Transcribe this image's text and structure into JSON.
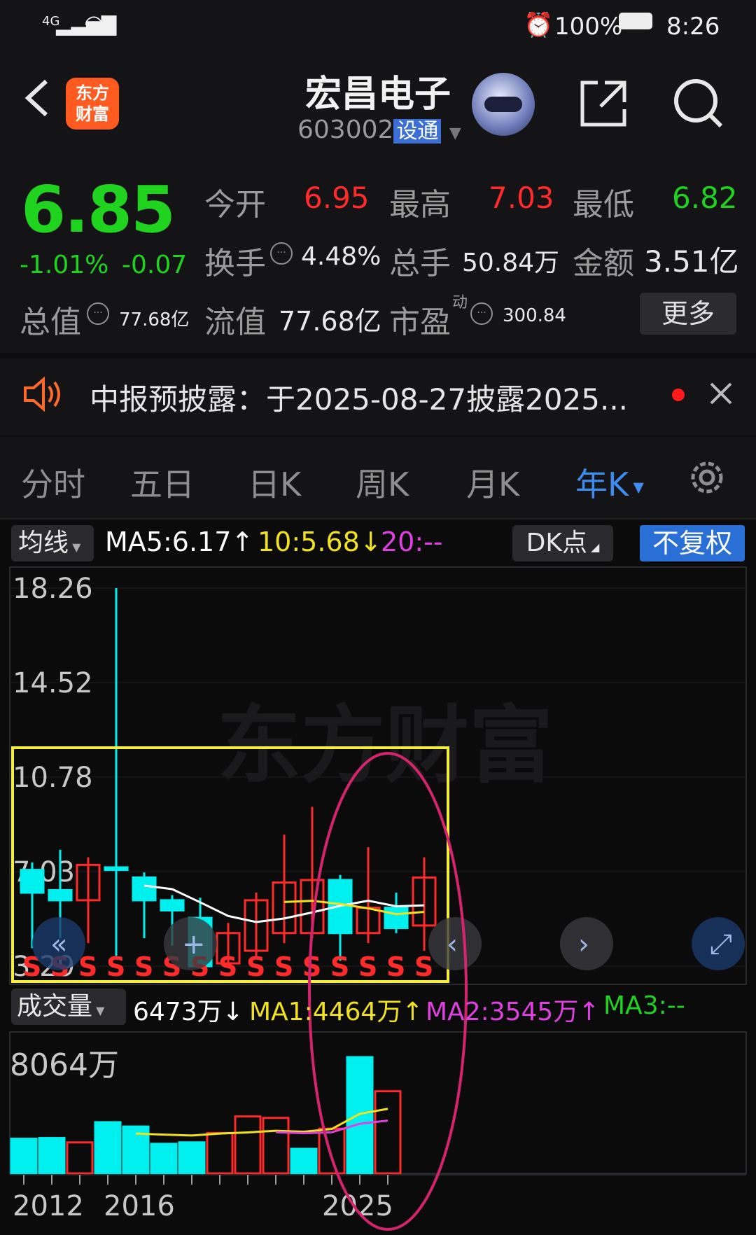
{
  "status": {
    "network": "4G",
    "battery": "100%",
    "time": "8:26"
  },
  "header": {
    "title": "宏昌电子",
    "code": "603002",
    "badge": "设通",
    "logo_line1": "东方",
    "logo_line2": "财富"
  },
  "quote": {
    "price": "6.85",
    "change_pct": "-1.01%",
    "change": "-0.07",
    "open_label": "今开",
    "open": "6.95",
    "high_label": "最高",
    "high": "7.03",
    "low_label": "最低",
    "low": "6.82",
    "turnover_label": "换手",
    "turnover": "4.48%",
    "volume_label": "总手",
    "volume": "50.84万",
    "amount_label": "金额",
    "amount": "3.51亿",
    "mktcap_label": "总值",
    "mktcap": "77.68亿",
    "float_label": "流值",
    "float": "77.68亿",
    "pe_label": "市盈",
    "pe_sup": "动",
    "pe": "300.84",
    "more_label": "更多"
  },
  "notice": {
    "text": "中报预披露：于2025-08-27披露2025..."
  },
  "tabs": [
    "分时",
    "五日",
    "日K",
    "周K",
    "月K",
    "年K"
  ],
  "active_tab": "年K",
  "indicators": {
    "ma_selector": "均线",
    "ma5": "MA5:6.17↑",
    "ma10": "10:5.68↓",
    "ma20": "20:--",
    "dk": "DK点",
    "adjust": "不复权"
  },
  "volume_bar": {
    "selector": "成交量",
    "current": "6473万↓",
    "ma1": "MA1:4464万↑",
    "ma2": "MA2:3545万↑",
    "ma3": "MA3:--"
  },
  "watermark": "东方财富",
  "colors": {
    "up": "#ff2a2a",
    "down": "#00f0f0",
    "ma5": "#ffffff",
    "ma10": "#f2e21e",
    "ma20": "#e040e0",
    "accent": "#3d8cf0"
  },
  "chart_data": {
    "type": "candlestick",
    "price_axis_labels": [
      "18.26",
      "14.52",
      "10.78",
      "7.03",
      "3.29"
    ],
    "volume_axis_label": "8064万",
    "x_tick_labels": [
      "2012",
      "2016",
      "2025"
    ],
    "signal_label": "S",
    "candles": [
      {
        "o": 7.1,
        "c": 6.2,
        "h": 7.4,
        "l": 4.0
      },
      {
        "o": 6.3,
        "c": 5.9,
        "h": 7.9,
        "l": 4.4
      },
      {
        "o": 5.9,
        "c": 7.3,
        "h": 7.6,
        "l": 4.2
      },
      {
        "o": 7.2,
        "c": 7.1,
        "h": 18.26,
        "l": 3.7
      },
      {
        "o": 6.8,
        "c": 5.9,
        "h": 7.0,
        "l": 4.4
      },
      {
        "o": 5.9,
        "c": 5.5,
        "h": 6.1,
        "l": 4.1
      },
      {
        "o": 5.2,
        "c": 3.29,
        "h": 6.0,
        "l": 3.29
      },
      {
        "o": 3.4,
        "c": 4.6,
        "h": 5.0,
        "l": 3.3
      },
      {
        "o": 3.9,
        "c": 5.9,
        "h": 6.2,
        "l": 3.6
      },
      {
        "o": 4.6,
        "c": 6.6,
        "h": 8.5,
        "l": 4.2
      },
      {
        "o": 4.6,
        "c": 6.7,
        "h": 9.6,
        "l": 4.4
      },
      {
        "o": 6.7,
        "c": 4.6,
        "h": 6.9,
        "l": 3.5
      },
      {
        "o": 4.6,
        "c": 5.6,
        "h": 8.0,
        "l": 4.2
      },
      {
        "o": 5.6,
        "c": 4.8,
        "h": 6.2,
        "l": 4.6
      },
      {
        "o": 4.9,
        "c": 6.8,
        "h": 7.6,
        "l": 3.9
      }
    ],
    "volume_wan": [
      2400,
      2450,
      2150,
      3550,
      3250,
      2050,
      2150,
      2800,
      3950,
      3850,
      1700,
      3100,
      8064,
      5700
    ],
    "volume_colors": [
      "down",
      "down",
      "up",
      "down",
      "down",
      "down",
      "down",
      "up",
      "up",
      "up",
      "down",
      "up",
      "down",
      "up"
    ]
  }
}
